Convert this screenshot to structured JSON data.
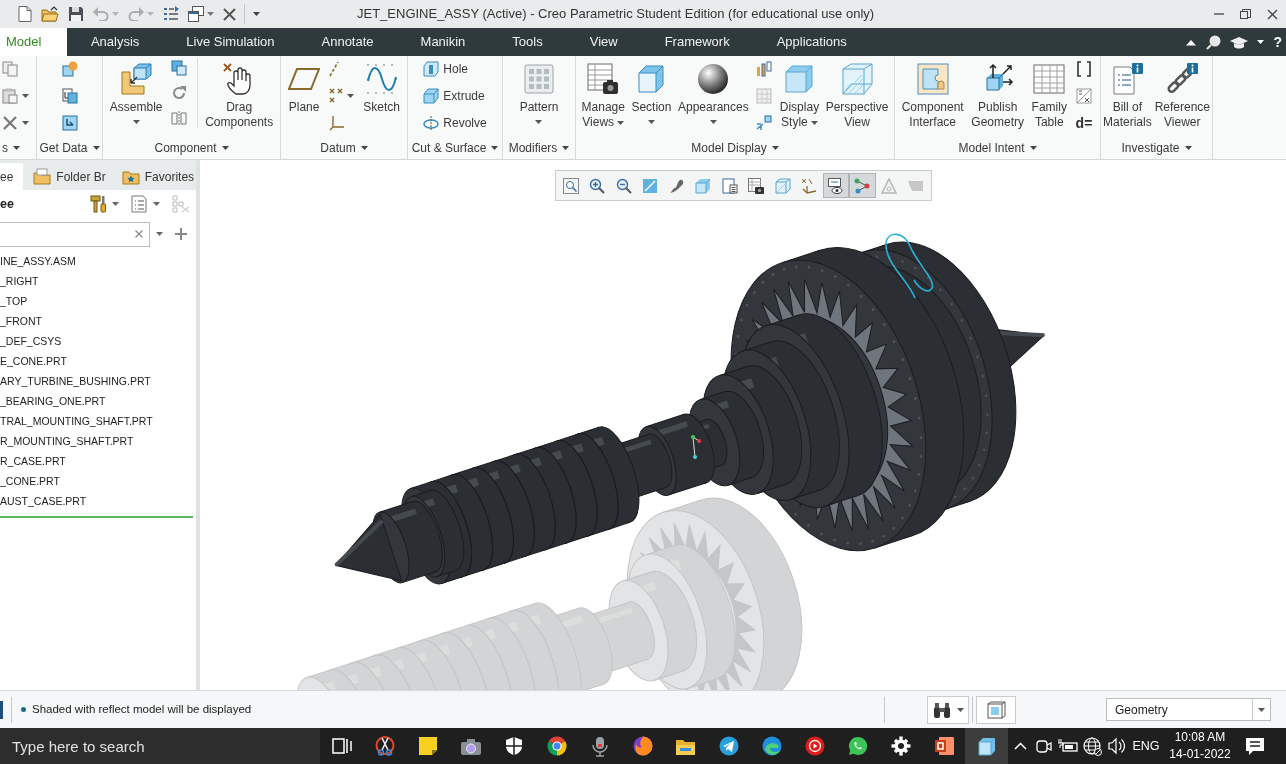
{
  "window": {
    "title": "JET_ENGINE_ASSY (Active) - Creo Parametric Student Edition (for educational use only)"
  },
  "quick_access": [
    {
      "caret": false,
      "disabled": false
    },
    {
      "caret": false,
      "disabled": false
    },
    {
      "caret": false,
      "disabled": false
    },
    {
      "caret": true,
      "disabled": true
    },
    {
      "caret": true,
      "disabled": true
    },
    {
      "caret": false,
      "disabled": false
    },
    {
      "caret": true,
      "disabled": false
    },
    {
      "caret": false,
      "disabled": false
    }
  ],
  "ribbon": {
    "tabs": [
      {
        "label": "Model",
        "selected": true
      },
      {
        "label": "Analysis",
        "selected": false
      },
      {
        "label": "Live Simulation",
        "selected": false
      },
      {
        "label": "Annotate",
        "selected": false
      },
      {
        "label": "Manikin",
        "selected": false
      },
      {
        "label": "Tools",
        "selected": false
      },
      {
        "label": "View",
        "selected": false
      },
      {
        "label": "Framework",
        "selected": false
      },
      {
        "label": "Applications",
        "selected": false
      }
    ],
    "help": "?",
    "groups": [
      {
        "label": "s",
        "items": [
          {
            "kind": "icons",
            "icons": [
              {
                "caret": false
              },
              {
                "caret": true
              },
              {
                "caret": true
              }
            ]
          }
        ]
      },
      {
        "label": "Get Data",
        "items": [
          {
            "kind": "icons",
            "icons": [
              {
                "caret": false
              },
              {
                "caret": false
              },
              {
                "caret": false
              }
            ]
          }
        ]
      },
      {
        "label": "Component",
        "items": [
          {
            "kind": "large",
            "lines": [
              "Assemble"
            ],
            "caret": true
          },
          {
            "kind": "icons",
            "icons": [
              {
                "caret": false
              },
              {
                "caret": false
              },
              {
                "caret": false
              }
            ]
          },
          {
            "kind": "large",
            "lines": [
              "Drag",
              "Components"
            ],
            "caret": false
          }
        ]
      },
      {
        "label": "Datum",
        "items": [
          {
            "kind": "large",
            "lines": [
              "Plane"
            ],
            "caret": false
          },
          {
            "kind": "icons",
            "icons": [
              {
                "caret": false
              },
              {
                "caret": true
              },
              {
                "caret": false
              }
            ]
          },
          {
            "kind": "large",
            "lines": [
              "Sketch"
            ],
            "caret": false
          }
        ]
      },
      {
        "label": "Cut & Surface",
        "items": [
          {
            "kind": "labeled",
            "tools": [
              {
                "label": "Hole"
              },
              {
                "label": "Extrude"
              },
              {
                "label": "Revolve"
              }
            ]
          }
        ]
      },
      {
        "label": "Modifiers",
        "items": [
          {
            "kind": "large",
            "lines": [
              "Pattern"
            ],
            "caret": true
          }
        ]
      },
      {
        "label": "Model Display",
        "items": [
          {
            "kind": "large",
            "lines": [
              "Manage",
              "Views"
            ],
            "caret": true
          },
          {
            "kind": "large",
            "lines": [
              "Section"
            ],
            "caret": true
          },
          {
            "kind": "large",
            "lines": [
              "Appearances"
            ],
            "caret": true
          },
          {
            "kind": "icons",
            "icons": [
              {
                "caret": false
              },
              {
                "caret": false
              },
              {
                "caret": false
              }
            ]
          },
          {
            "kind": "large",
            "lines": [
              "Display",
              "Style"
            ],
            "caret": true
          },
          {
            "kind": "large",
            "lines": [
              "Perspective",
              "View"
            ],
            "caret": false
          }
        ]
      },
      {
        "label": "Model Intent",
        "items": [
          {
            "kind": "large",
            "lines": [
              "Component",
              "Interface"
            ],
            "caret": false
          },
          {
            "kind": "large",
            "lines": [
              "Publish",
              "Geometry"
            ],
            "caret": false
          },
          {
            "kind": "large",
            "lines": [
              "Family",
              "Table"
            ],
            "caret": false
          },
          {
            "kind": "icons",
            "icons": [
              {
                "caret": false
              },
              {
                "caret": false
              },
              {
                "glyph": "d="
              }
            ]
          }
        ]
      },
      {
        "label": "Investigate",
        "items": [
          {
            "kind": "large",
            "lines": [
              "Bill of",
              "Materials"
            ],
            "caret": false
          },
          {
            "kind": "large",
            "lines": [
              "Reference",
              "Viewer"
            ],
            "caret": false
          }
        ]
      }
    ]
  },
  "tree": {
    "tabs": [
      {
        "label": "ee",
        "selected": true
      },
      {
        "label": "Folder Br",
        "selected": false
      },
      {
        "label": "Favorites",
        "selected": false
      }
    ],
    "title": "ee",
    "items": [
      "INE_ASSY.ASM",
      "_RIGHT",
      "_TOP",
      "_FRONT",
      "_DEF_CSYS",
      "E_CONE.PRT",
      "ARY_TURBINE_BUSHING.PRT",
      "_BEARING_ONE.PRT",
      "TRAL_MOUNTING_SHAFT.PRT",
      "R_MOUNTING_SHAFT.PRT",
      "R_CASE.PRT",
      "_CONE.PRT",
      "AUST_CASE.PRT"
    ]
  },
  "view_toolbar": [
    {
      "on": false,
      "disabled": false
    },
    {
      "on": false,
      "disabled": false
    },
    {
      "on": false,
      "disabled": false
    },
    {
      "on": false,
      "disabled": false
    },
    {
      "on": false,
      "disabled": false
    },
    {
      "on": false,
      "disabled": false
    },
    {
      "on": false,
      "disabled": false
    },
    {
      "on": false,
      "disabled": false
    },
    {
      "on": false,
      "disabled": false
    },
    {
      "on": false,
      "disabled": false
    },
    {
      "on": true,
      "disabled": false
    },
    {
      "on": true,
      "disabled": false
    },
    {
      "on": false,
      "disabled": true
    },
    {
      "on": false,
      "disabled": true
    }
  ],
  "status_bar": {
    "message": "Shaded with reflect model will be displayed",
    "filter": "Geometry"
  },
  "taskbar": {
    "search": {
      "placeholder": "Type here to search"
    },
    "apps": [
      {
        "active": false
      },
      {
        "active": false
      },
      {
        "active": false
      },
      {
        "active": false
      },
      {
        "active": false
      },
      {
        "active": false
      },
      {
        "active": false
      },
      {
        "active": false
      },
      {
        "active": false
      },
      {
        "active": false
      },
      {
        "active": false
      },
      {
        "active": false
      },
      {
        "active": false
      },
      {
        "active": false
      },
      {
        "active": false
      },
      {
        "active": true
      }
    ],
    "language": "ENG",
    "time": "10:08 AM",
    "date": "14-01-2022"
  }
}
